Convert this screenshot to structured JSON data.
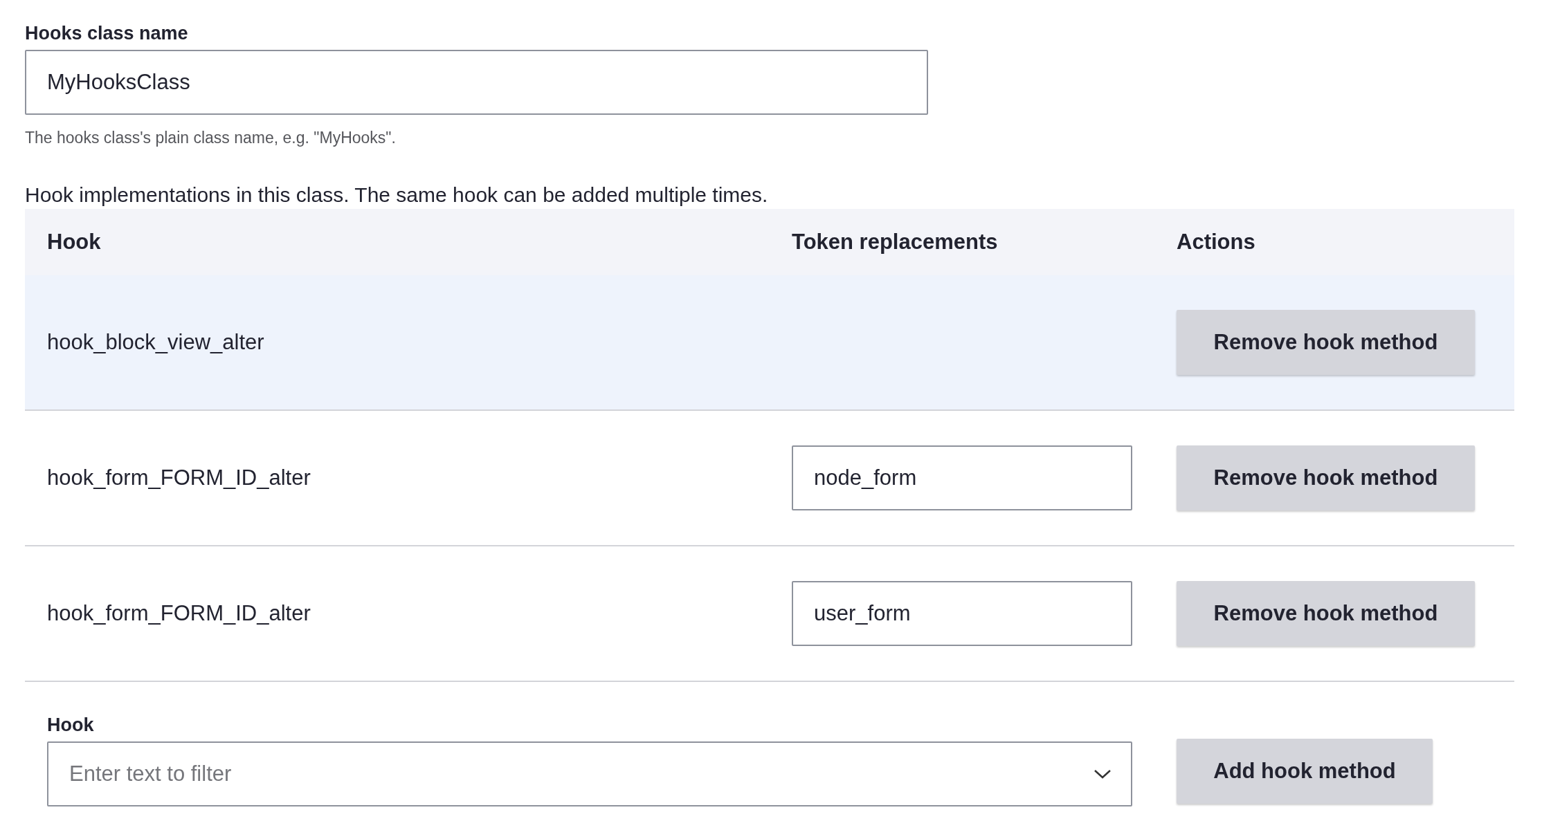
{
  "class_field": {
    "label": "Hooks class name",
    "value": "MyHooksClass",
    "description": "The hooks class's plain class name, e.g. \"MyHooks\"."
  },
  "intro": "Hook implementations in this class. The same hook can be added multiple times.",
  "table": {
    "columns": [
      "Hook",
      "Token replacements",
      "Actions"
    ],
    "rows": [
      {
        "hook": "hook_block_view_alter",
        "highlighted": true,
        "action": "Remove hook method"
      },
      {
        "hook": "hook_form_FORM_ID_alter",
        "token": "node_form",
        "highlighted": false,
        "action": "Remove hook method"
      },
      {
        "hook": "hook_form_FORM_ID_alter",
        "token": "user_form",
        "highlighted": false,
        "action": "Remove hook method"
      }
    ]
  },
  "add_row": {
    "label": "Hook",
    "placeholder": "Enter text to filter",
    "button": "Add hook method"
  }
}
